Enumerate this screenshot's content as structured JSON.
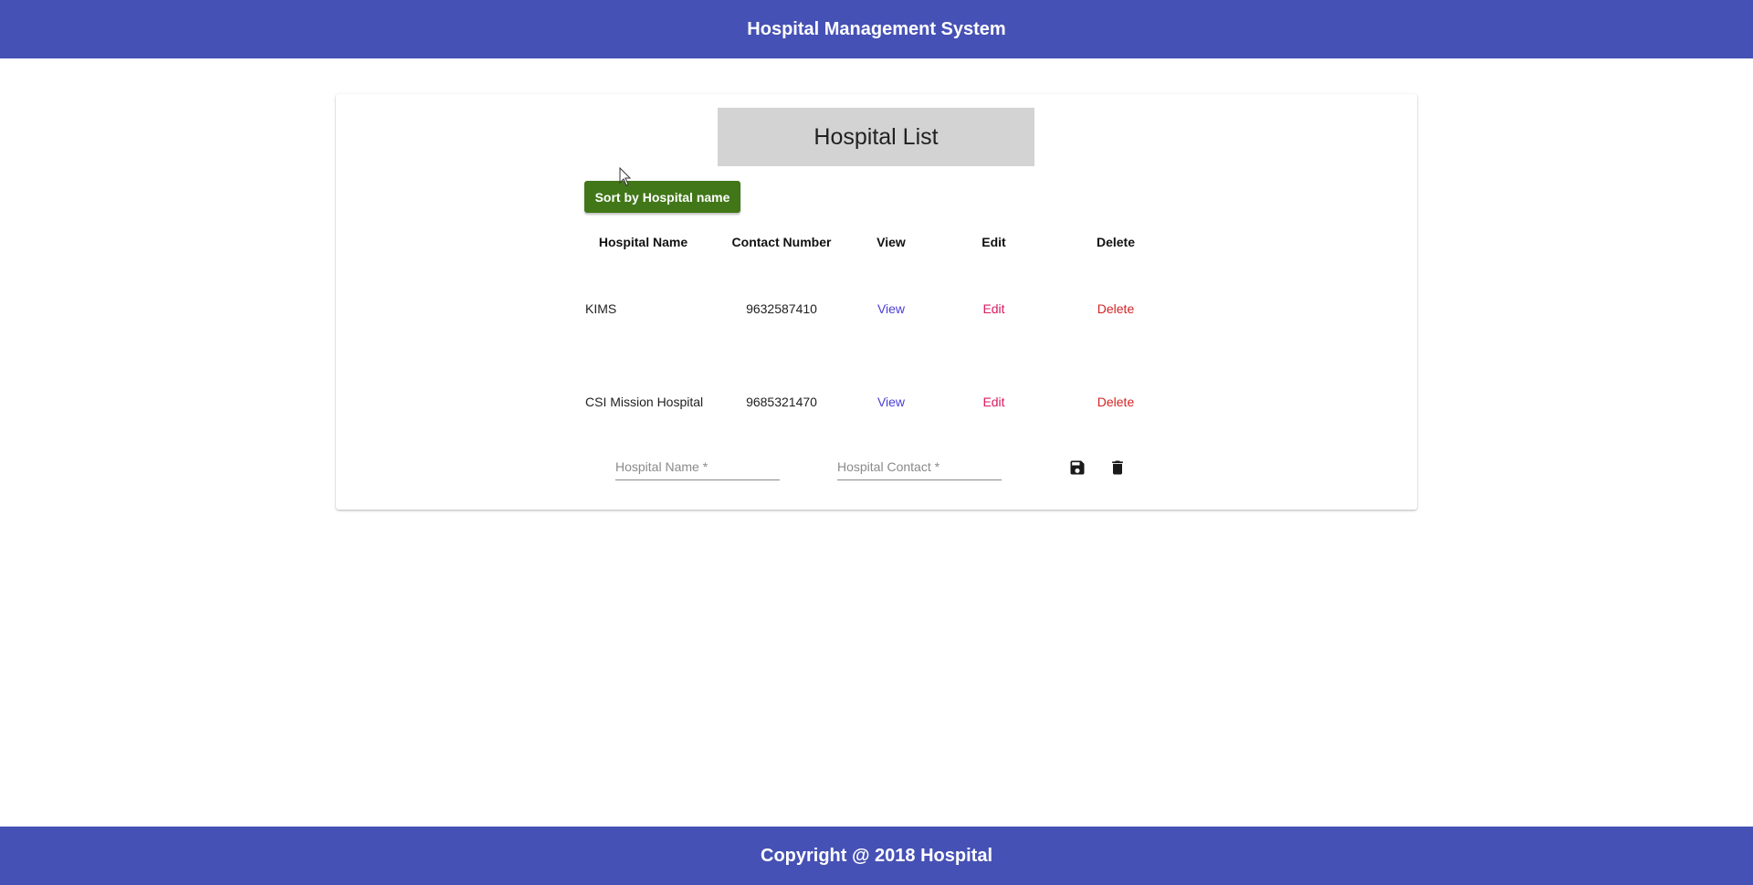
{
  "header": {
    "title": "Hospital Management System"
  },
  "card": {
    "title": "Hospital List",
    "sort_button": "Sort by Hospital name",
    "columns": [
      "Hospital Name",
      "Contact Number",
      "View",
      "Edit",
      "Delete"
    ],
    "rows": [
      {
        "name": "KIMS",
        "contact": "9632587410",
        "view": "View",
        "edit": "Edit",
        "delete": "Delete"
      },
      {
        "name": "CSI Mission Hospital",
        "contact": "9685321470",
        "view": "View",
        "edit": "Edit",
        "delete": "Delete"
      }
    ],
    "form": {
      "name_placeholder": "Hospital Name *",
      "contact_placeholder": "Hospital Contact *",
      "name_value": "",
      "contact_value": "",
      "save_icon": "save-icon",
      "delete_icon": "trash-icon"
    }
  },
  "footer": {
    "text": "Copyright @ 2018 Hospital"
  },
  "colors": {
    "bar": "#4651b5",
    "sort_button": "#417718",
    "view_link": "#4a3ed6",
    "edit_link": "#d81b60",
    "delete_link": "#d32222",
    "title_box": "#d3d3d3"
  }
}
